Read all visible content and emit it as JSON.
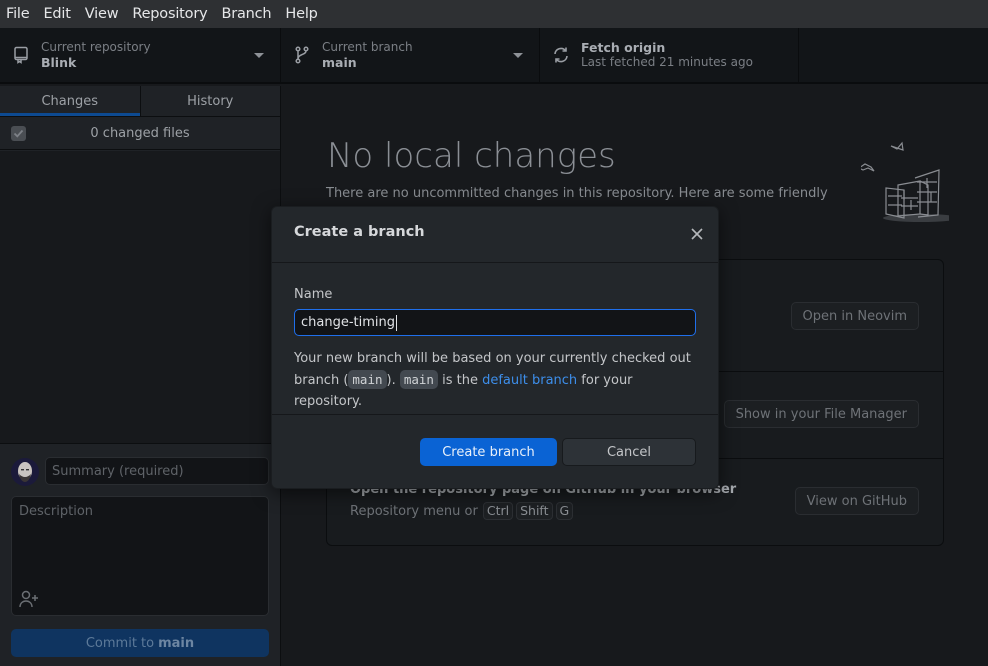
{
  "menu": [
    "File",
    "Edit",
    "View",
    "Repository",
    "Branch",
    "Help"
  ],
  "toolbar": {
    "repo": {
      "label": "Current repository",
      "value": "Blink",
      "icon": "repo-icon"
    },
    "branch": {
      "label": "Current branch",
      "value": "main",
      "icon": "git-branch-icon"
    },
    "fetch": {
      "label": "Fetch origin",
      "sub": "Last fetched 21 minutes ago",
      "icon": "sync-icon"
    }
  },
  "sidebar": {
    "tabs": [
      {
        "label": "Changes",
        "active": true
      },
      {
        "label": "History",
        "active": false
      }
    ],
    "changed_files": "0 changed files",
    "commit": {
      "summary_placeholder": "Summary (required)",
      "description_placeholder": "Description",
      "button_prefix": "Commit to",
      "button_branch": "main"
    }
  },
  "main": {
    "title": "No local changes",
    "subtitle": "There are no uncommitted changes in this repository. Here are some friendly",
    "actions": [
      {
        "button": "Open in Neovim"
      },
      {
        "button": "Show in your File Manager"
      },
      {
        "title": "Open the repository page on GitHub in your browser",
        "desc_prefix": "Repository menu or",
        "keys": [
          "Ctrl",
          "Shift",
          "G"
        ],
        "button": "View on GitHub"
      }
    ]
  },
  "dialog": {
    "title": "Create a branch",
    "name_label": "Name",
    "name_value": "change-timing",
    "help": {
      "part1": "Your new branch will be based on your currently checked out branch (",
      "branch1": "main",
      "part2": "). ",
      "branch2": "main",
      "part3": " is the ",
      "link": "default branch",
      "part4": " for your repository."
    },
    "primary_button": "Create branch",
    "cancel_button": "Cancel"
  },
  "colors": {
    "accent": "#0a63d4",
    "link": "#3d8eea",
    "focus_border": "#1f6feb"
  }
}
